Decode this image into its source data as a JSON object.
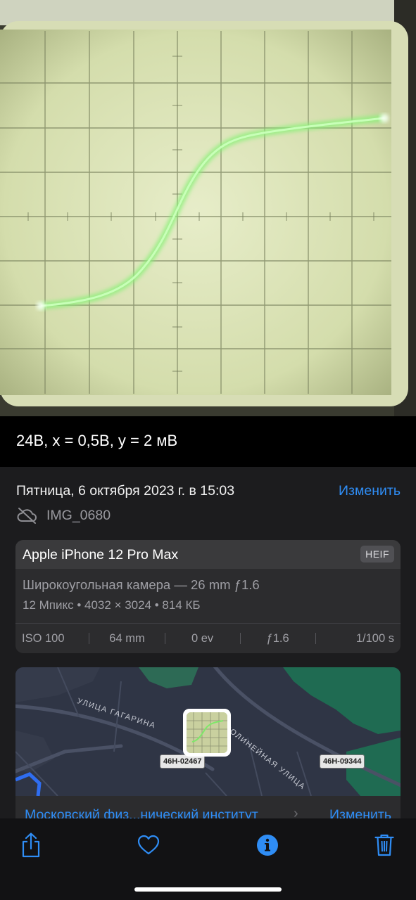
{
  "photo": {
    "alt": "Oscilloscope screen photo"
  },
  "caption": "24В, x = 0,5В, y = 2 мВ",
  "info": {
    "date": "Пятница, 6 октября 2023 г. в 15:03",
    "edit_label": "Изменить",
    "file_name": "IMG_0680",
    "file_icon": "cloud-off-icon"
  },
  "camera": {
    "device": "Apple iPhone 12 Pro Max",
    "format": "HEIF",
    "lens": "Широкоугольная камера — 26 mm ƒ1.6",
    "specs": "12 Мпикс  •  4032 × 3024  •  814 КБ",
    "exif": [
      "ISO 100",
      "64 mm",
      "0 ev",
      "ƒ1.6",
      "1/100 s"
    ]
  },
  "map": {
    "street_1": "УЛИЦА ГАГАРИНА",
    "street_2": "ПРАВОЛИНЕЙНАЯ УЛИЦА",
    "plate_1": "46H-02467",
    "plate_2": "46H-09344"
  },
  "location": {
    "name": "Московский физ...нический институт",
    "edit_label": "Изменить"
  },
  "toolbar": {
    "items": [
      "share-icon",
      "heart-icon",
      "info-icon",
      "trash-icon"
    ]
  },
  "colors": {
    "accent": "#2f8df5",
    "panel": "#1c1c1e",
    "card": "#2c2c2e",
    "trace": "#9cff8a"
  }
}
